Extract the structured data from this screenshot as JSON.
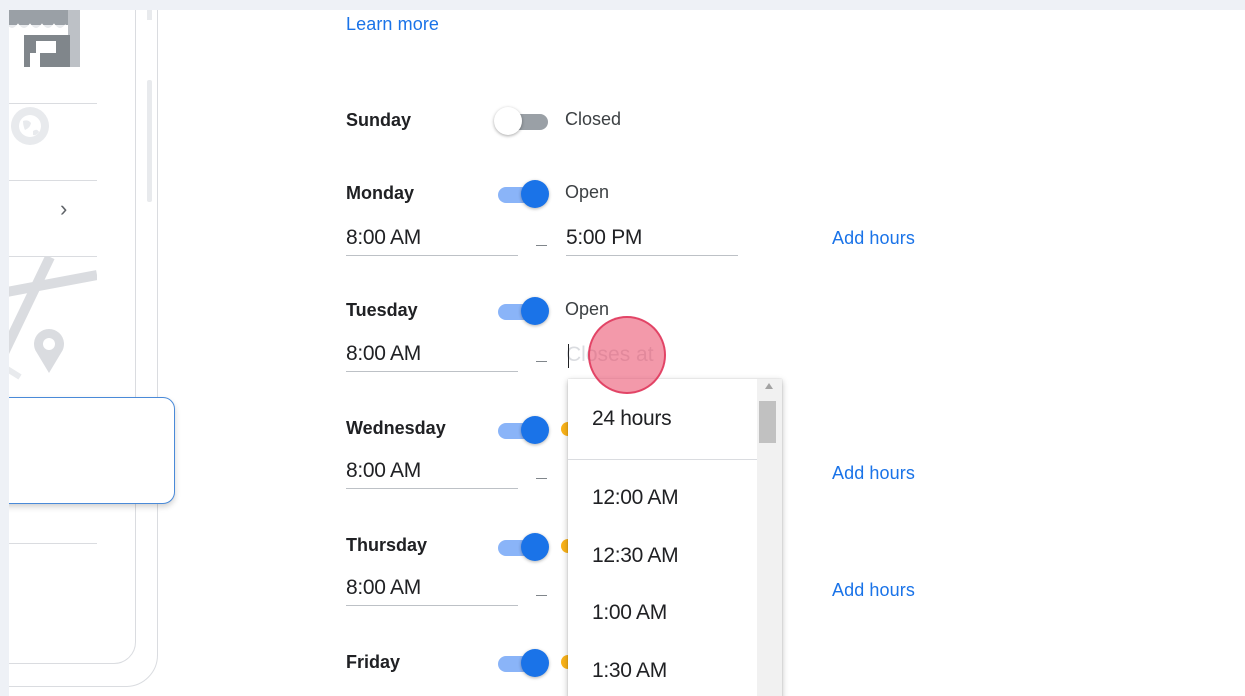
{
  "hours_intro": {
    "learn_more": "Learn more"
  },
  "days": [
    {
      "day": "Sunday",
      "status": "Closed",
      "is_open": false
    },
    {
      "day": "Monday",
      "status": "Open",
      "is_open": true,
      "opens_at": "8:00 AM",
      "closes_at": "5:00 PM",
      "add_hours": "Add hours"
    },
    {
      "day": "Tuesday",
      "status": "Open",
      "is_open": true,
      "opens_at": "8:00 AM",
      "closes_at_placeholder": "Closes at"
    },
    {
      "day": "Wednesday",
      "is_open": true,
      "opens_at": "8:00 AM",
      "add_hours": "Add hours"
    },
    {
      "day": "Thursday",
      "is_open": true,
      "opens_at": "8:00 AM",
      "add_hours": "Add hours"
    },
    {
      "day": "Friday",
      "is_open": true
    }
  ],
  "closes_dropdown": {
    "options": [
      "24 hours",
      "12:00 AM",
      "12:30 AM",
      "1:00 AM",
      "1:30 AM"
    ]
  },
  "colors": {
    "accent": "#1a73e8",
    "toggle_track_on": "#8ab4f8",
    "toggle_track_off": "#9aa0a6",
    "click_marker": "#e94664"
  },
  "icons": {
    "preview_store": "storefront-icon",
    "preview_globe": "globe-icon",
    "preview_chevron": "chevron-right-icon",
    "preview_pin": "map-pin-icon"
  }
}
